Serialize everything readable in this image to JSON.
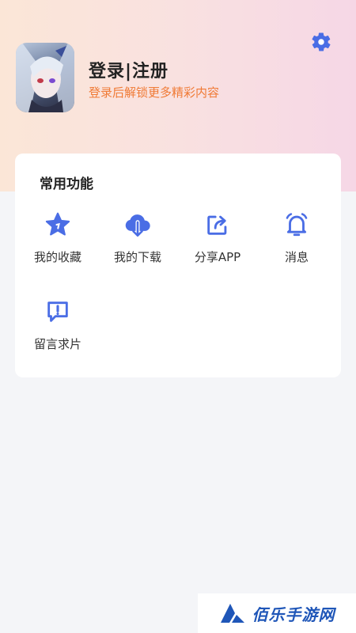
{
  "header": {
    "title": "登录|注册",
    "subtitle": "登录后解锁更多精彩内容",
    "settings_icon": "gear-icon"
  },
  "functions": {
    "title": "常用功能",
    "items": [
      {
        "label": "我的收藏",
        "icon": "star-icon"
      },
      {
        "label": "我的下载",
        "icon": "cloud-download-icon"
      },
      {
        "label": "分享APP",
        "icon": "share-icon"
      },
      {
        "label": "消息",
        "icon": "bell-icon"
      },
      {
        "label": "留言求片",
        "icon": "message-alert-icon"
      }
    ]
  },
  "watermark": {
    "text": "佰乐手游网"
  },
  "colors": {
    "accent": "#4a6de5",
    "subtitle": "#f07a35"
  }
}
